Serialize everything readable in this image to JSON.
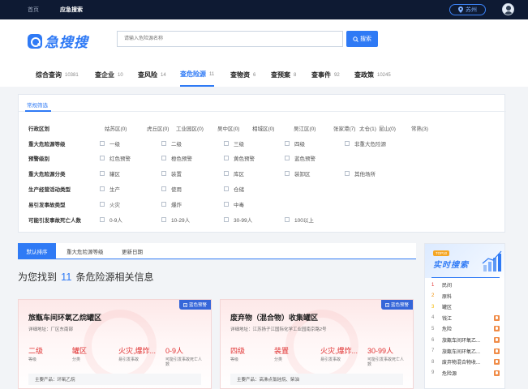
{
  "topbar": {
    "nav": [
      "首页",
      "应急搜索"
    ],
    "location": "苏州"
  },
  "header": {
    "logo_text": "急搜搜",
    "search_placeholder": "请输入危险源名称",
    "search_button": "搜索"
  },
  "tabs": [
    {
      "label": "综合查询",
      "count": "10381"
    },
    {
      "label": "查企业",
      "count": "10"
    },
    {
      "label": "查风险",
      "count": "14"
    },
    {
      "label": "查危险源",
      "count": "11"
    },
    {
      "label": "查物资",
      "count": "6"
    },
    {
      "label": "查预案",
      "count": "8"
    },
    {
      "label": "查事件",
      "count": "92"
    },
    {
      "label": "查政策",
      "count": "10245"
    }
  ],
  "filter": {
    "tab": "常规筛选",
    "rows": [
      {
        "label": "行政区划",
        "checkbox": false,
        "options": [
          "姑苏区(0)",
          "虎丘区(0)",
          "工业园区(0)",
          "吴中区(0)",
          "相城区(0)",
          "吴江区(0)",
          "张家港(7)",
          "太仓(1)",
          "昆山(0)",
          "常熟(3)"
        ]
      },
      {
        "label": "重大危险源等级",
        "checkbox": true,
        "options": [
          "一级",
          "二级",
          "三级",
          "四级",
          "非重大危险源"
        ]
      },
      {
        "label": "预警级别",
        "checkbox": true,
        "options": [
          "红色预警",
          "橙色预警",
          "黄色预警",
          "蓝色预警"
        ]
      },
      {
        "label": "重大危险源分类",
        "checkbox": true,
        "options": [
          "罐区",
          "装置",
          "库区",
          "装卸区",
          "其他场所"
        ]
      },
      {
        "label": "生产经营活动类型",
        "checkbox": true,
        "options": [
          "生产",
          "使用",
          "仓储"
        ]
      },
      {
        "label": "易引发事故类型",
        "checkbox": true,
        "options": [
          "火灾",
          "爆炸",
          "中毒"
        ]
      },
      {
        "label": "可能引发事故死亡人数",
        "checkbox": true,
        "options": [
          "0-9人",
          "10-29人",
          "30-99人",
          "100以上"
        ]
      }
    ]
  },
  "sort": [
    "默认排序",
    "重大危险源等级",
    "更新日期"
  ],
  "result": {
    "prefix": "为您找到",
    "count": "11",
    "suffix": "条危险源相关信息"
  },
  "cards": [
    {
      "badge": "蓝色预警",
      "title": "旅甑车间环氧乙烷罐区",
      "address": "详细地址：厂区东南部",
      "stats": [
        {
          "value": "二级",
          "label": "等级"
        },
        {
          "value": "罐区",
          "label": "分类"
        },
        {
          "value": "火灾,爆炸...",
          "label": "易引发事故"
        },
        {
          "value": "0-9人",
          "label": "可能引发事故死亡人数"
        }
      ],
      "product": "主要产品：环氧乙烷"
    },
    {
      "badge": "蓝色预警",
      "title": "废弃物（混合物）收集罐区",
      "address": "详细地址：江苏扬子江国际化学工业园南京路2号",
      "stats": [
        {
          "value": "四级",
          "label": "等级"
        },
        {
          "value": "装置",
          "label": "分类"
        },
        {
          "value": "火灾,爆炸...",
          "label": "易引发事故"
        },
        {
          "value": "30-99人",
          "label": "可能引发事故死亡人数"
        }
      ],
      "product": "主要产品：高沸点氯硅烷、柴油"
    }
  ],
  "sidebar": {
    "badge": "TOP10",
    "title": "实时搜索",
    "items": [
      {
        "rank": "1",
        "text": "民间",
        "hot": false
      },
      {
        "rank": "2",
        "text": "原料",
        "hot": false
      },
      {
        "rank": "3",
        "text": "罐区",
        "hot": false
      },
      {
        "rank": "4",
        "text": "钱江",
        "hot": true
      },
      {
        "rank": "5",
        "text": "危险",
        "hot": true
      },
      {
        "rank": "6",
        "text": "旅甑车间环氧乙...",
        "hot": true
      },
      {
        "rank": "7",
        "text": "旅甑车间环氧乙...",
        "hot": true
      },
      {
        "rank": "8",
        "text": "废弃物混合物收...",
        "hot": true
      },
      {
        "rank": "9",
        "text": "危险源",
        "hot": true
      }
    ]
  },
  "colors": {
    "accent": "#2f7af5",
    "danger": "#e03131",
    "topbar": "#0e1a33"
  }
}
